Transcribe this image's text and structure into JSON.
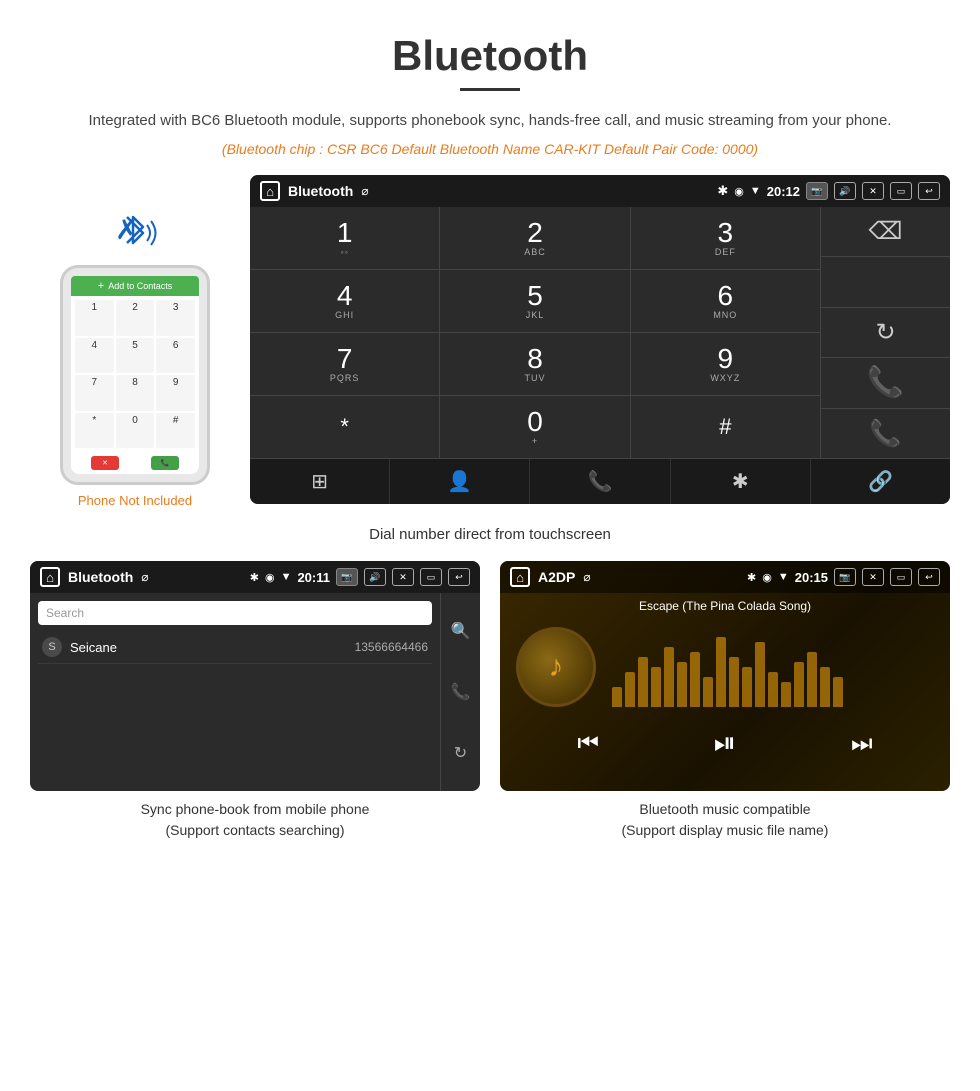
{
  "page": {
    "title": "Bluetooth",
    "subtitle": "Integrated with BC6 Bluetooth module, supports phonebook sync, hands-free call, and music streaming from your phone.",
    "orange_info": "(Bluetooth chip : CSR BC6    Default Bluetooth Name CAR-KIT    Default Pair Code: 0000)",
    "dial_caption": "Dial number direct from touchscreen",
    "phonebook_caption_line1": "Sync phone-book from mobile phone",
    "phonebook_caption_line2": "(Support contacts searching)",
    "music_caption_line1": "Bluetooth music compatible",
    "music_caption_line2": "(Support display music file name)"
  },
  "dialpad_screen": {
    "status_bar": {
      "home_icon": "⌂",
      "title": "Bluetooth",
      "usb_icon": "⌀",
      "time": "20:12",
      "icons": [
        "📷",
        "🔊",
        "✕",
        "▭",
        "↩"
      ]
    },
    "keys": [
      {
        "num": "1",
        "sub": "◦◦"
      },
      {
        "num": "2",
        "sub": "ABC"
      },
      {
        "num": "3",
        "sub": "DEF"
      },
      {
        "num": "4",
        "sub": "GHI"
      },
      {
        "num": "5",
        "sub": "JKL"
      },
      {
        "num": "6",
        "sub": "MNO"
      },
      {
        "num": "7",
        "sub": "PQRS"
      },
      {
        "num": "8",
        "sub": "TUV"
      },
      {
        "num": "9",
        "sub": "WXYZ"
      },
      {
        "num": "*",
        "sub": ""
      },
      {
        "num": "0",
        "sub": "+"
      },
      {
        "num": "#",
        "sub": ""
      }
    ],
    "bottom_nav": [
      "⊞",
      "👤",
      "📞",
      "✱",
      "🔗"
    ]
  },
  "phonebook_screen": {
    "title": "Bluetooth",
    "time": "20:11",
    "search_placeholder": "Search",
    "contact": {
      "letter": "S",
      "name": "Seicane",
      "number": "13566664466"
    }
  },
  "music_screen": {
    "title": "A2DP",
    "time": "20:15",
    "song_title": "Escape (The Pina Colada Song)",
    "wave_heights": [
      20,
      35,
      50,
      40,
      60,
      45,
      55,
      30,
      70,
      50,
      40,
      65,
      35,
      25,
      45,
      55,
      40,
      30
    ]
  },
  "phone_mock": {
    "add_contacts": "Add to Contacts",
    "not_included": "Phone Not Included",
    "keys": [
      "1",
      "2",
      "3",
      "4",
      "5",
      "6",
      "7",
      "8",
      "9",
      "*",
      "0",
      "#"
    ]
  }
}
